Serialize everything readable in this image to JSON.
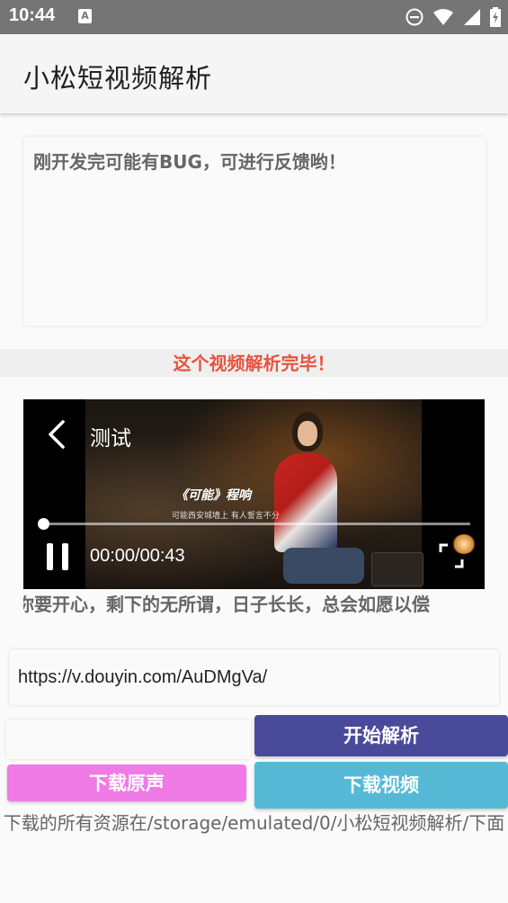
{
  "status_bar": {
    "time": "10:44",
    "icons": [
      "keyboard-a-icon",
      "do-not-disturb-icon",
      "wifi-icon",
      "signal-icon",
      "battery-icon"
    ]
  },
  "app_bar": {
    "title": "小松短视频解析"
  },
  "notice": {
    "text": "刚开发完可能有BUG，可进行反馈哟！"
  },
  "parse_status": {
    "text": "这个视频解析完毕！",
    "color": "#e8533f"
  },
  "player": {
    "title": "测试",
    "time": "00:00/00:43",
    "subtitle_title": "《可能》程响",
    "subtitle_line": "可能西安城墙上 有人誓言不分",
    "progress": 0.0
  },
  "marquee": {
    "text": "你要开心，剩下的无所谓，日子长长，总会如愿以偿"
  },
  "url_input": {
    "value": "https://v.douyin.com/AuDMgVa/"
  },
  "buttons": {
    "parse": "开始解析",
    "download_audio": "下载原声",
    "download_video": "下载视频"
  },
  "colors": {
    "parse_button": "#4a4a9a",
    "audio_button": "#f07ae6",
    "video_button": "#55b9d6"
  },
  "footer": {
    "text": "下载的所有资源在/storage/emulated/0/小松短视频解析/下面"
  }
}
